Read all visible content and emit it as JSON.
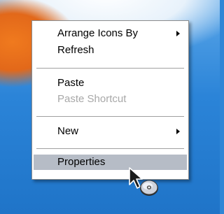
{
  "context_menu": {
    "items": [
      {
        "label": "Arrange Icons By",
        "submenu": true,
        "enabled": true
      },
      {
        "label": "Refresh",
        "submenu": false,
        "enabled": true
      },
      {
        "label": "Paste",
        "submenu": false,
        "enabled": true
      },
      {
        "label": "Paste Shortcut",
        "submenu": false,
        "enabled": false
      },
      {
        "label": "New",
        "submenu": true,
        "enabled": true
      },
      {
        "label": "Properties",
        "submenu": false,
        "enabled": true,
        "highlighted": true
      }
    ]
  },
  "cursor": {
    "icon": "arrow-cursor-with-cd-icon"
  },
  "colors": {
    "menu_background": "#ffffff",
    "highlight": "#b6bcc6",
    "disabled_text": "#a8a8a8",
    "desktop_blue": "#2b84d8",
    "desktop_orange": "#e2681a"
  }
}
